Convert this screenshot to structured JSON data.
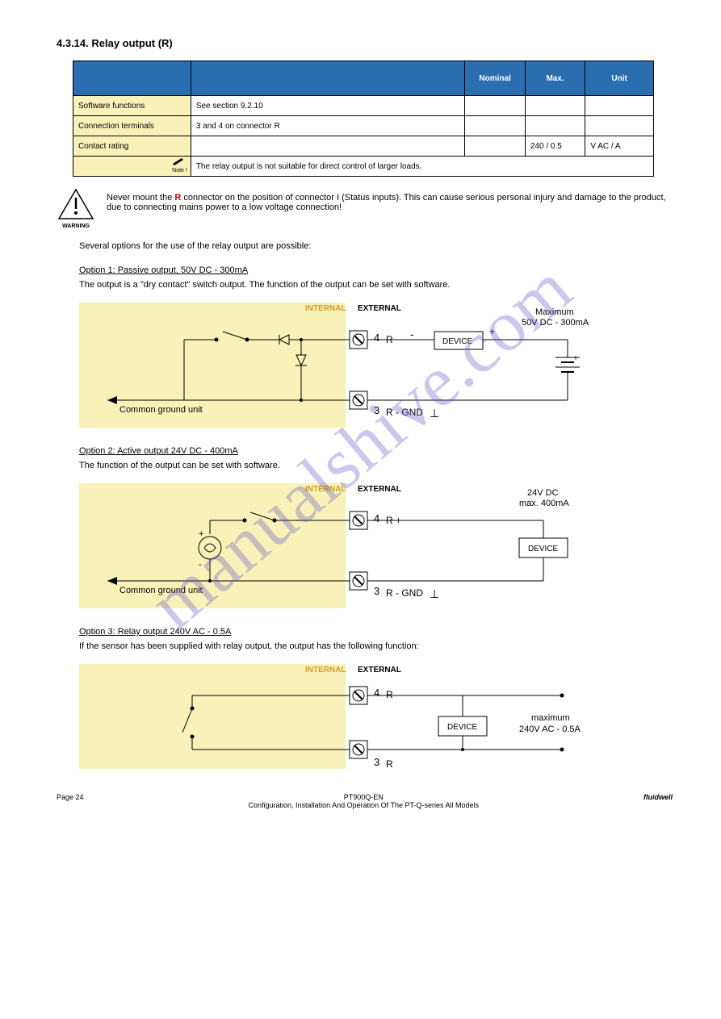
{
  "watermark": "manualshive.com",
  "section_title": "4.3.14. Relay output (R)",
  "table": {
    "headers": [
      "",
      "",
      "Nominal",
      "Max.",
      "Unit"
    ],
    "rows": [
      {
        "label": "Software functions",
        "col2": "See section 9.2.10",
        "nom": "",
        "max": "",
        "unit": ""
      },
      {
        "label": "Connection terminals",
        "col2": "3 and 4 on connector R",
        "nom": "",
        "max": "",
        "unit": ""
      },
      {
        "label": "Contact rating",
        "col2": "",
        "nom": "",
        "max": "240 / 0.5",
        "unit": "V AC / A"
      }
    ],
    "note": "The relay output is not suitable for direct control of larger loads."
  },
  "warning_text_parts": {
    "prefix": "Never mount the ",
    "red": "R",
    "suffix": " connector on the position of connector I (Status inputs). This can cause serious personal injury and damage to the product, due to connecting mains power to a low voltage connection!"
  },
  "body_text": "Several options for the use of the relay output are possible:",
  "options": {
    "opt1": {
      "title": "Option 1: Passive output, 50V DC - 300mA",
      "desc": "The output is a \"dry contact\" switch output. The function of the output can be set with software.",
      "labels": {
        "internal": "INTERNAL",
        "external": "EXTERNAL",
        "max_line1": "Maximum",
        "max_line2": "50V DC - 300mA",
        "pin4": "4",
        "pin3": "3",
        "r": "R",
        "rgnd": "R - GND",
        "device": "DEVICE",
        "ground": "Common ground unit",
        "minus": "-",
        "plus": "+",
        "gndsym": "⊥"
      }
    },
    "opt2": {
      "title": "Option 2: Active output 24V DC - 400mA",
      "desc": "The function of the output can be set with software.",
      "labels": {
        "internal": "INTERNAL",
        "external": "EXTERNAL",
        "max_line1": "24V DC",
        "max_line2": "max. 400mA",
        "pin4": "4",
        "pin3": "3",
        "rplus": "R +",
        "rgnd": "R - GND",
        "device": "DEVICE",
        "ground": "Common ground unit",
        "plus": "+",
        "minus": "-",
        "gndsym": "⊥"
      }
    },
    "opt3": {
      "title": "Option 3: Relay output 240V AC - 0.5A",
      "desc": "If the sensor has been supplied with relay output, the output has the following function:",
      "labels": {
        "internal": "INTERNAL",
        "external": "EXTERNAL",
        "max_line1": "maximum",
        "max_line2": "240V AC - 0.5A",
        "pin4": "4",
        "pin3": "3",
        "r": "R",
        "device": "DEVICE"
      }
    }
  },
  "footer": {
    "left": "Page 24",
    "center_line1": "PT900Q-EN",
    "center_line2": "Configuration, Installation And Operation Of The PT-Q-series All Models",
    "right": "fluidwell"
  }
}
